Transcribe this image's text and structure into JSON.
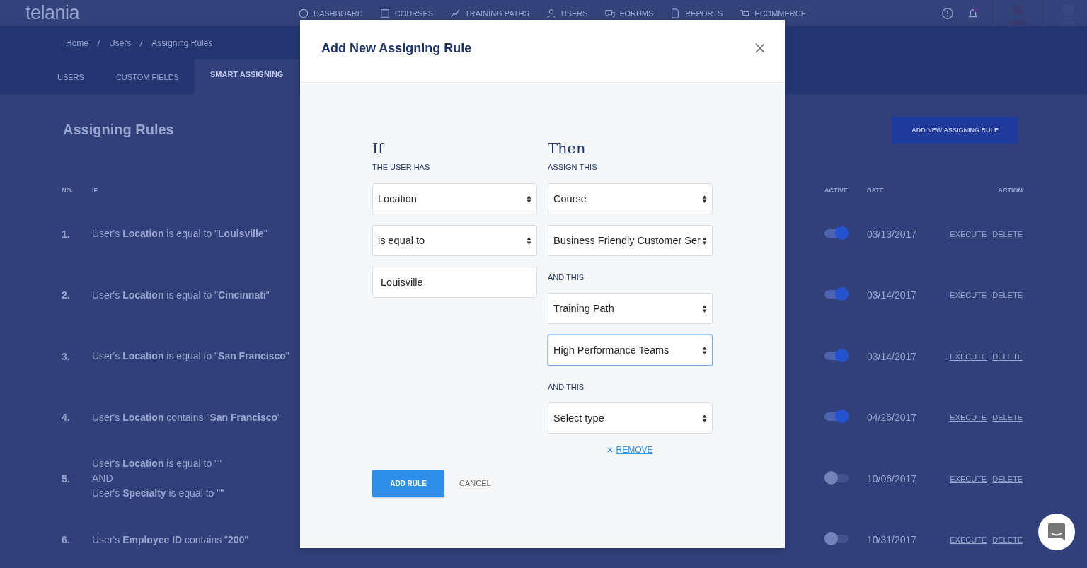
{
  "header": {
    "logo": "telania",
    "nav": [
      {
        "label": "DASHBOARD"
      },
      {
        "label": "COURSES"
      },
      {
        "label": "TRAINING PATHS"
      },
      {
        "label": "USERS"
      },
      {
        "label": "FORUMS"
      },
      {
        "label": "REPORTS"
      },
      {
        "label": "ECOMMERCE"
      }
    ]
  },
  "breadcrumb": [
    "Home",
    "Users",
    "Assigning Rules"
  ],
  "tabs": [
    {
      "label": "USERS",
      "selected": false
    },
    {
      "label": "CUSTOM FIELDS",
      "selected": false
    },
    {
      "label": "SMART ASSIGNING",
      "selected": true
    }
  ],
  "page_title": "Assigning Rules",
  "add_rule_button": "ADD NEW ASSIGNING RULE",
  "table": {
    "columns": [
      "NO.",
      "IF",
      "ACTIVE",
      "DATE",
      "ACTION"
    ],
    "rows": [
      {
        "no": "1.",
        "condition": "User's **Location** is equal to \"**Louisville**\"",
        "active": true,
        "date": "03/13/2017",
        "actions": [
          "EXECUTE",
          "DELETE"
        ]
      },
      {
        "no": "2.",
        "condition": "User's **Location** is equal to \"**Cincinnati**\"",
        "active": true,
        "date": "03/14/2017",
        "actions": [
          "EXECUTE",
          "DELETE"
        ]
      },
      {
        "no": "3.",
        "condition": "User's **Location** is equal to \"**San Francisco**\"",
        "active": true,
        "date": "03/14/2017",
        "actions": [
          "EXECUTE",
          "DELETE"
        ]
      },
      {
        "no": "4.",
        "condition": "User's **Location** contains \"**San Francisco**\"",
        "active": true,
        "date": "04/26/2017",
        "actions": [
          "EXECUTE",
          "DELETE"
        ]
      },
      {
        "no": "5.",
        "condition": "User's **Location** is equal to \"\"\nAND\nUser's **Specialty** is equal to \"\"",
        "active": false,
        "date": "10/06/2017",
        "actions": [
          "EXECUTE",
          "DELETE"
        ]
      },
      {
        "no": "6.",
        "condition": "User's **Employee ID** contains \"**200**\"",
        "active": false,
        "date": "10/31/2017",
        "actions": [
          "EXECUTE",
          "DELETE"
        ]
      }
    ]
  },
  "modal": {
    "title": "Add New Assigning Rule",
    "if_heading": "If",
    "if_label": "THE USER HAS",
    "if_fields": [
      {
        "kind": "select",
        "value": "Location",
        "focused": false
      },
      {
        "kind": "select",
        "value": "is equal to",
        "focused": false
      },
      {
        "kind": "input",
        "value": "Louisville",
        "focused": false
      }
    ],
    "then_heading": "Then",
    "then_groups": [
      {
        "label": "ASSIGN THIS",
        "fields": [
          {
            "kind": "select",
            "value": "Course",
            "focused": false
          },
          {
            "kind": "select",
            "value": "Business Friendly Customer Ser",
            "focused": false
          }
        ]
      },
      {
        "label": "AND THIS",
        "fields": [
          {
            "kind": "select",
            "value": "Training Path",
            "focused": false
          },
          {
            "kind": "select",
            "value": "High Performance Teams",
            "focused": true
          }
        ]
      },
      {
        "label": "AND THIS",
        "fields": [
          {
            "kind": "select",
            "value": "Select type",
            "focused": false
          }
        ]
      }
    ],
    "remove_link": "REMOVE",
    "submit_button": "ADD RULE",
    "cancel_link": "CANCEL"
  }
}
